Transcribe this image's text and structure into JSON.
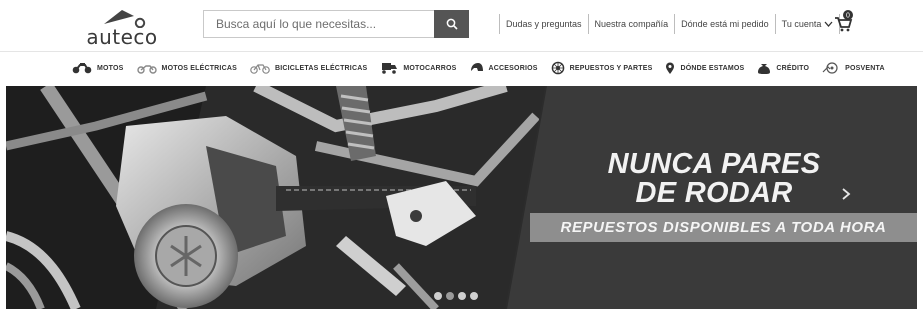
{
  "brand": {
    "logo_text": "auteco"
  },
  "search": {
    "placeholder": "Busca aquí lo que necesitas...",
    "value": ""
  },
  "header_links": {
    "faq": "Dudas y preguntas",
    "company": "Nuestra compañía",
    "order_status": "Dónde está mi pedido",
    "account": "Tu cuenta"
  },
  "cart": {
    "count": "0"
  },
  "nav": {
    "items": [
      {
        "label": "MOTOS",
        "icon": "motorcycle-icon"
      },
      {
        "label": "MOTOS ELÉCTRICAS",
        "icon": "electric-motorcycle-icon"
      },
      {
        "label": "BICICLETAS ELÉCTRICAS",
        "icon": "electric-bicycle-icon"
      },
      {
        "label": "MOTOCARROS",
        "icon": "motocarro-icon"
      },
      {
        "label": "ACCESORIOS",
        "icon": "helmet-icon"
      },
      {
        "label": "REPUESTOS Y PARTES",
        "icon": "gear-icon"
      },
      {
        "label": "DÓNDE ESTAMOS",
        "icon": "location-pin-icon"
      },
      {
        "label": "CRÉDITO",
        "icon": "money-bag-icon"
      },
      {
        "label": "POSVENTA",
        "icon": "service-icon"
      }
    ]
  },
  "hero": {
    "headline_line1": "NUNCA PARES",
    "headline_line2": "DE RODAR",
    "subtitle": "REPUESTOS DISPONIBLES  A TODA HORA",
    "slide_count": 4,
    "active_slide": 1
  },
  "colors": {
    "dark_panel": "#3a3a3a",
    "strip": "#8e8e8e",
    "search_button": "#555555"
  }
}
